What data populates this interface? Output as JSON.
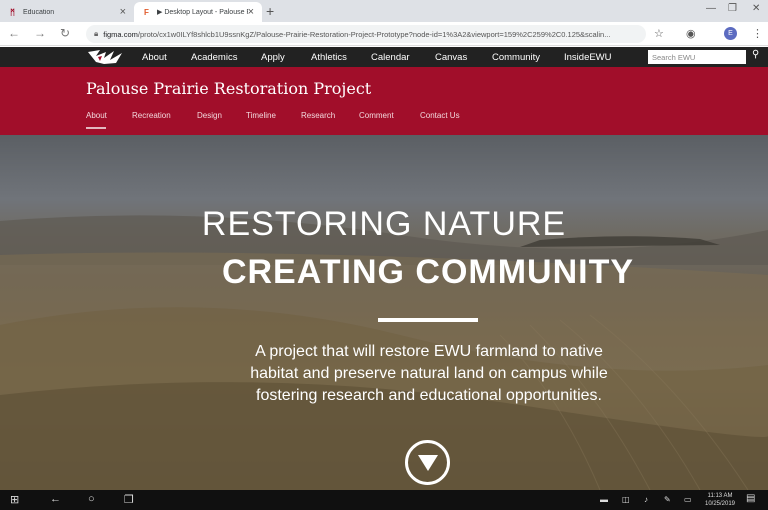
{
  "browser": {
    "tabs": [
      {
        "title": "Education",
        "favicon": "ewu-logo-icon"
      },
      {
        "title": "▶ Desktop Layout - Palouse P",
        "favicon": "figma-icon"
      }
    ],
    "new_tab_symbol": "+",
    "address": {
      "host": "figma.com",
      "path": "/proto/cx1w0ILYf8shlcb1U9ssnKgZ/Palouse-Prairie-Restoration-Project-Prototype?node-id=1%3A2&viewport=159%2C259%2C0.125&scalin..."
    },
    "profile_initial": "E"
  },
  "site": {
    "search_placeholder": "Search EWU",
    "nav": [
      "About",
      "Academics",
      "Apply",
      "Athletics",
      "Calendar",
      "Canvas",
      "Community",
      "InsideEWU"
    ],
    "banner_title": "Palouse Prairie Restoration Project",
    "subnav": [
      "About",
      "Recreation",
      "Design",
      "Timeline",
      "Research",
      "Comment",
      "Contact Us"
    ]
  },
  "hero": {
    "line1": "RESTORING NATURE",
    "line2": "CREATING COMMUNITY",
    "desc_lines": [
      "A project that will restore EWU farmland to native",
      "habitat and preserve natural land on campus while",
      "fostering research and educational opportunities."
    ]
  },
  "taskbar": {
    "time": "11:13 AM",
    "date": "10/25/2019"
  },
  "colors": {
    "brand_red": "#a10e2a",
    "topnav_bg": "#222222"
  }
}
